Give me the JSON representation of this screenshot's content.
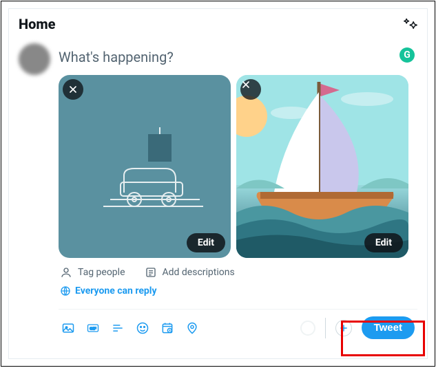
{
  "header": {
    "title": "Home"
  },
  "compose": {
    "placeholder": "What's happening?",
    "grammarly_badge": "G"
  },
  "media": [
    {
      "edit_label": "Edit"
    },
    {
      "edit_label": "Edit"
    }
  ],
  "meta": {
    "tag_people": "Tag people",
    "add_descriptions": "Add descriptions"
  },
  "reply": {
    "label": "Everyone can reply"
  },
  "footer": {
    "tweet_label": "Tweet"
  },
  "colors": {
    "accent": "#1d9bf0"
  }
}
